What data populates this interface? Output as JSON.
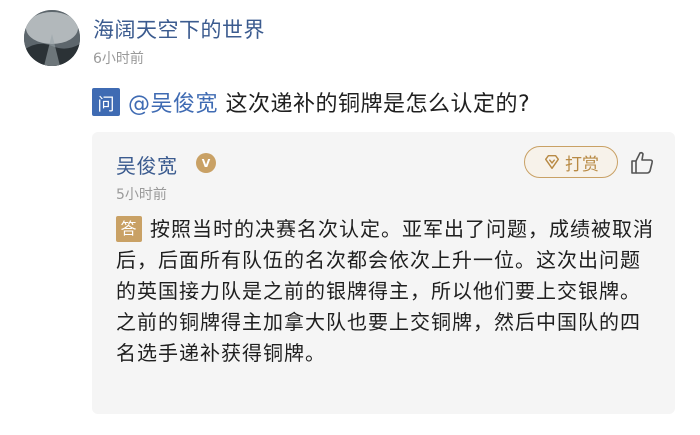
{
  "post": {
    "username": "海阔天空下的世界",
    "time": "6小时前"
  },
  "question": {
    "badge": "问",
    "mention": "@吴俊宽",
    "text": "这次递补的铜牌是怎么认定的?"
  },
  "answer": {
    "answerer": "吴俊宽",
    "verified_badge": "V",
    "tip_label": "打赏",
    "time": "5小时前",
    "badge": "答",
    "text": "按照当时的决赛名次认定。亚军出了问题，成绩被取消后，后面所有队伍的名次都会依次上升一位。这次出问题的英国接力队是之前的银牌得主，所以他们要上交银牌。之前的铜牌得主加拿大队也要上交铜牌，然后中国队的四名选手递补获得铜牌。"
  },
  "colors": {
    "link": "#3b5b8f",
    "question_badge": "#3f6bb3",
    "answer_badge": "#c9a165",
    "muted": "#9a9a9a",
    "card_bg": "#f5f5f5"
  },
  "icons": {
    "avatar": "landscape-avatar",
    "tip": "diamond-coin-icon",
    "like": "thumbs-up-icon",
    "verified": "verified-v-icon"
  }
}
